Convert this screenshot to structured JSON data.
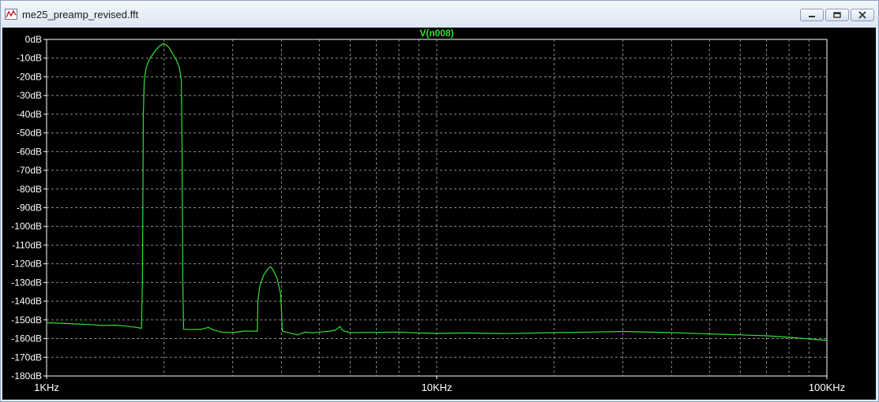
{
  "window": {
    "title": "me25_preamp_revised.fft",
    "controls": [
      "minimize",
      "restore",
      "close"
    ]
  },
  "colors": {
    "background": "#000000",
    "trace": "#33e033",
    "title": "#33e033",
    "axis_text": "#ffffff",
    "grid": "#8a8a8a"
  },
  "chart_data": {
    "type": "line",
    "title": "V(n008)",
    "xscale": "log",
    "xlim": [
      1000,
      100000
    ],
    "ylim": [
      -180,
      0
    ],
    "grid": true,
    "x_tick_labels": [
      {
        "value": 1000,
        "label": "1KHz"
      },
      {
        "value": 10000,
        "label": "10KHz"
      },
      {
        "value": 100000,
        "label": "100KHz"
      }
    ],
    "y_tick_labels": [
      {
        "value": 0,
        "label": "0dB"
      },
      {
        "value": -10,
        "label": "-10dB"
      },
      {
        "value": -20,
        "label": "-20dB"
      },
      {
        "value": -30,
        "label": "-30dB"
      },
      {
        "value": -40,
        "label": "-40dB"
      },
      {
        "value": -50,
        "label": "-50dB"
      },
      {
        "value": -60,
        "label": "-60dB"
      },
      {
        "value": -70,
        "label": "-70dB"
      },
      {
        "value": -80,
        "label": "-80dB"
      },
      {
        "value": -90,
        "label": "-90dB"
      },
      {
        "value": -100,
        "label": "-100dB"
      },
      {
        "value": -110,
        "label": "-110dB"
      },
      {
        "value": -120,
        "label": "-120dB"
      },
      {
        "value": -130,
        "label": "-130dB"
      },
      {
        "value": -140,
        "label": "-140dB"
      },
      {
        "value": -150,
        "label": "-150dB"
      },
      {
        "value": -160,
        "label": "-160dB"
      },
      {
        "value": -170,
        "label": "-170dB"
      },
      {
        "value": -180,
        "label": "-180dB"
      }
    ],
    "series": [
      {
        "name": "V(n008)",
        "points": [
          [
            1000,
            -151.5
          ],
          [
            1150,
            -152.0
          ],
          [
            1300,
            -152.5
          ],
          [
            1400,
            -153.0
          ],
          [
            1500,
            -152.8
          ],
          [
            1600,
            -153.3
          ],
          [
            1700,
            -154.0
          ],
          [
            1750,
            -154.5
          ],
          [
            1760,
            -130
          ],
          [
            1770,
            -40
          ],
          [
            1780,
            -22
          ],
          [
            1800,
            -15
          ],
          [
            1830,
            -11
          ],
          [
            1870,
            -8
          ],
          [
            1910,
            -5.5
          ],
          [
            1950,
            -3.5
          ],
          [
            1980,
            -2.5
          ],
          [
            2000,
            -2.3
          ],
          [
            2030,
            -3
          ],
          [
            2070,
            -5
          ],
          [
            2110,
            -8
          ],
          [
            2150,
            -11
          ],
          [
            2190,
            -15
          ],
          [
            2215,
            -22
          ],
          [
            2225,
            -60
          ],
          [
            2235,
            -130
          ],
          [
            2245,
            -155
          ],
          [
            2350,
            -155.2
          ],
          [
            2500,
            -155.0
          ],
          [
            2600,
            -154.0
          ],
          [
            2650,
            -155.0
          ],
          [
            2800,
            -156.5
          ],
          [
            3000,
            -156.8
          ],
          [
            3200,
            -156.0
          ],
          [
            3470,
            -156.0
          ],
          [
            3480,
            -140
          ],
          [
            3520,
            -132
          ],
          [
            3600,
            -126
          ],
          [
            3700,
            -122.5
          ],
          [
            3750,
            -121.5
          ],
          [
            3800,
            -123.0
          ],
          [
            3900,
            -128
          ],
          [
            3980,
            -136
          ],
          [
            4000,
            -145
          ],
          [
            4020,
            -156
          ],
          [
            4200,
            -157.0
          ],
          [
            4400,
            -158.0
          ],
          [
            4600,
            -156.5
          ],
          [
            4800,
            -157.0
          ],
          [
            5000,
            -156.5
          ],
          [
            5300,
            -156.0
          ],
          [
            5500,
            -155.5
          ],
          [
            5650,
            -153.5
          ],
          [
            5700,
            -155.0
          ],
          [
            5800,
            -156.0
          ],
          [
            6000,
            -156.8
          ],
          [
            7000,
            -156.7
          ],
          [
            8000,
            -156.5
          ],
          [
            9000,
            -157.0
          ],
          [
            10000,
            -157.2
          ],
          [
            12000,
            -157.0
          ],
          [
            15000,
            -157.3
          ],
          [
            20000,
            -156.8
          ],
          [
            25000,
            -156.5
          ],
          [
            30000,
            -156.2
          ],
          [
            40000,
            -156.8
          ],
          [
            50000,
            -157.5
          ],
          [
            60000,
            -158.0
          ],
          [
            70000,
            -158.5
          ],
          [
            80000,
            -159.3
          ],
          [
            90000,
            -160.2
          ],
          [
            100000,
            -161.0
          ]
        ]
      }
    ]
  }
}
